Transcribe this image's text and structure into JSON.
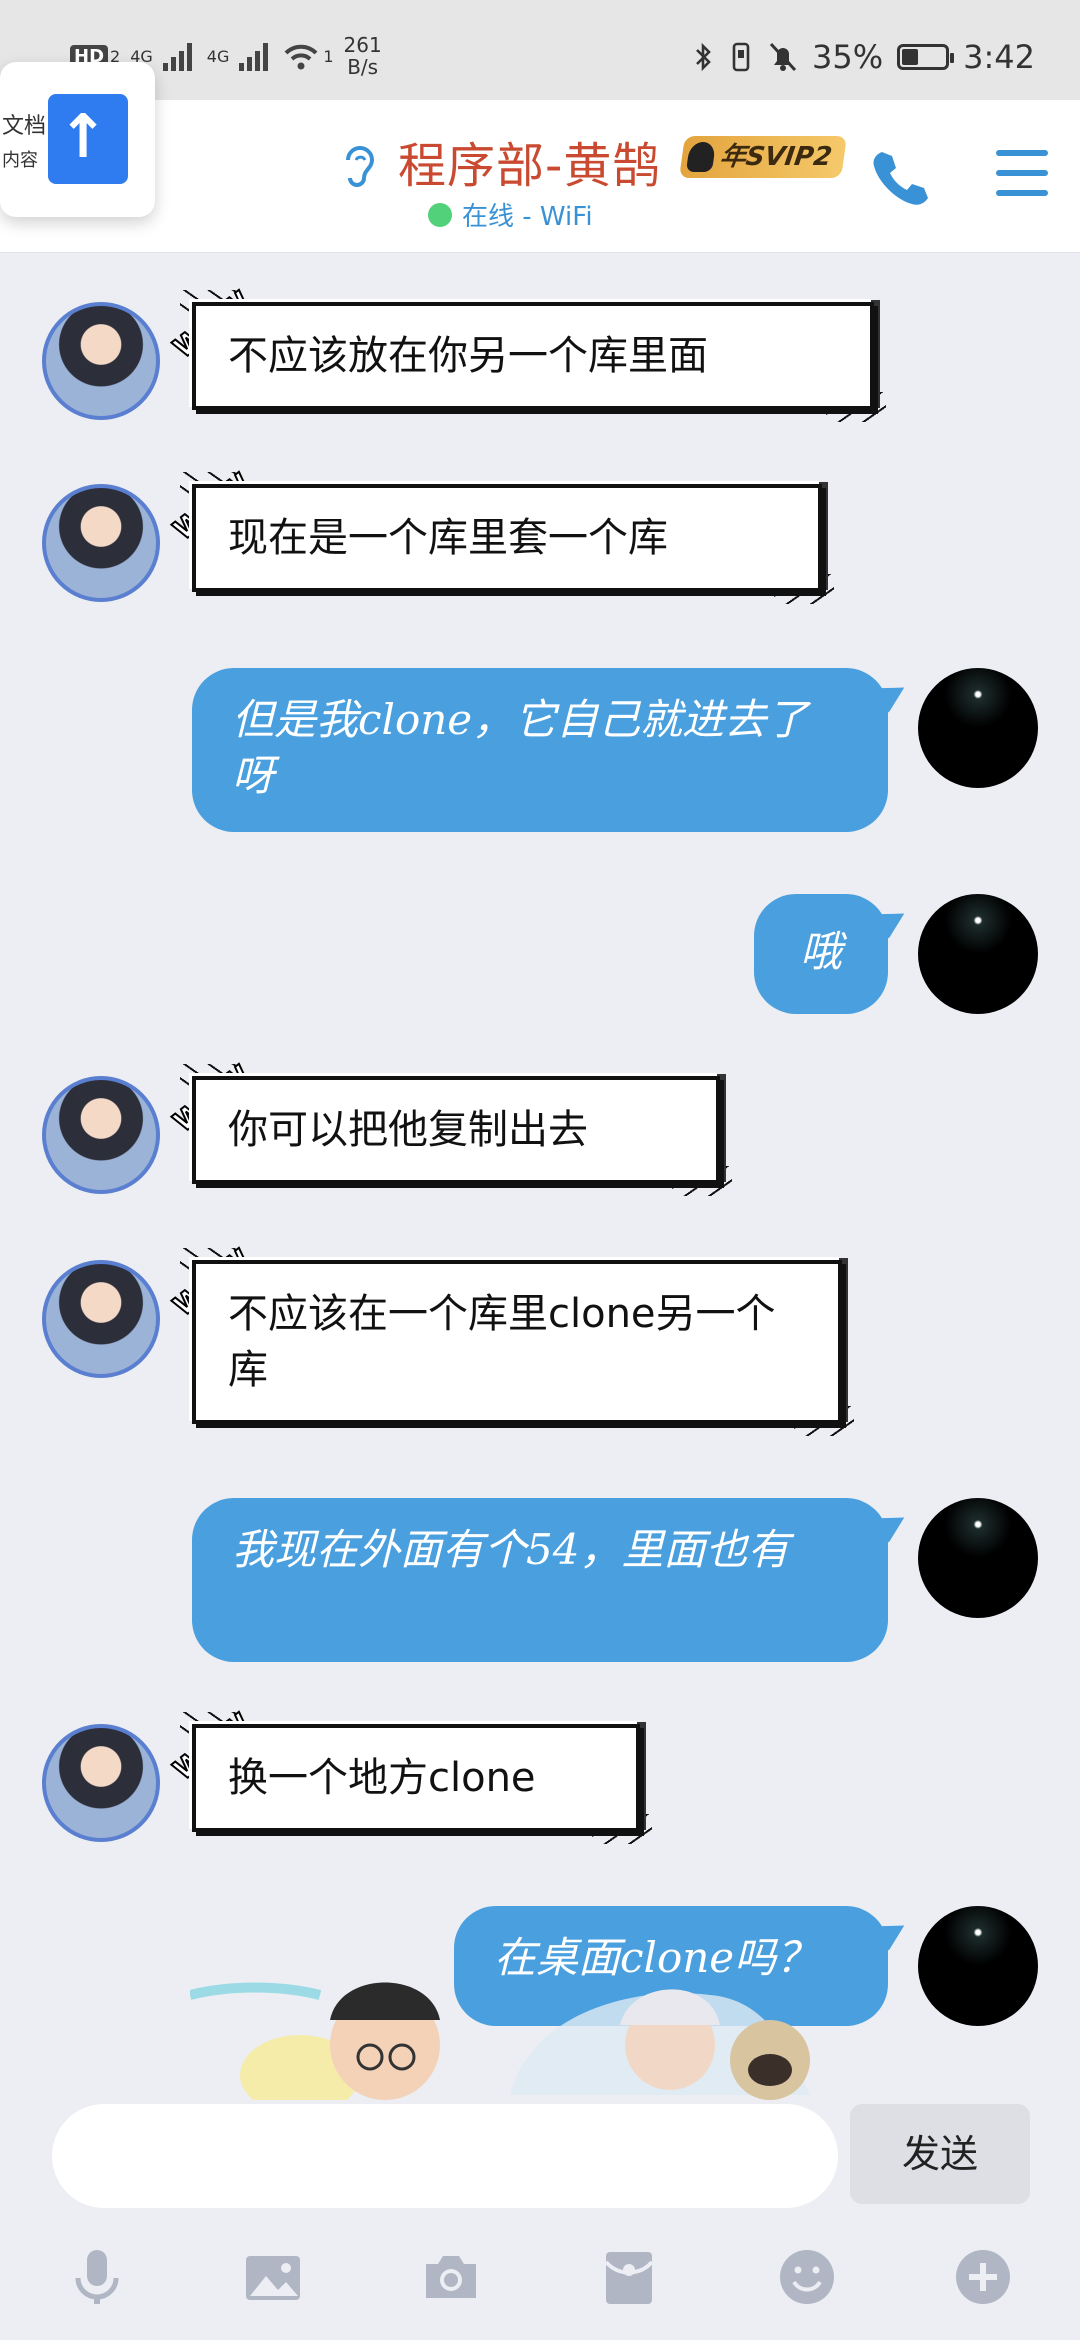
{
  "status_bar": {
    "hd": "HD",
    "hd_sub": "2",
    "net1": "4G",
    "net2": "4G",
    "wifi_sub": "1",
    "speed_value": "261",
    "speed_unit": "B/s",
    "battery": "35%",
    "time": "3:42"
  },
  "floating_card": {
    "line1": "文档",
    "line2": "内容"
  },
  "header": {
    "title": "程序部-黄鹄",
    "badge": "年SVIP2",
    "presence": "在线 - WiFi",
    "accent": "#3a92d6",
    "title_color": "#c94a31"
  },
  "messages": [
    {
      "side": "left",
      "text": "不应该放在你另一个库里面"
    },
    {
      "side": "left",
      "text": "现在是一个库里套一个库"
    },
    {
      "side": "right",
      "text": "但是我clone，它自己就进去了呀"
    },
    {
      "side": "right",
      "text": "哦"
    },
    {
      "side": "left",
      "text": "你可以把他复制出去"
    },
    {
      "side": "left",
      "text": "不应该在一个库里clone另一个库"
    },
    {
      "side": "right",
      "text": "我现在外面有个54，里面也有"
    },
    {
      "side": "left",
      "text": "换一个地方clone"
    },
    {
      "side": "right",
      "text": "在桌面clone吗？"
    }
  ],
  "bubble_tag": "WOW",
  "input": {
    "placeholder": "",
    "send_label": "发送"
  },
  "toolbar": [
    "mic-icon",
    "image-icon",
    "camera-icon",
    "red-packet-icon",
    "emoji-icon",
    "plus-icon"
  ]
}
